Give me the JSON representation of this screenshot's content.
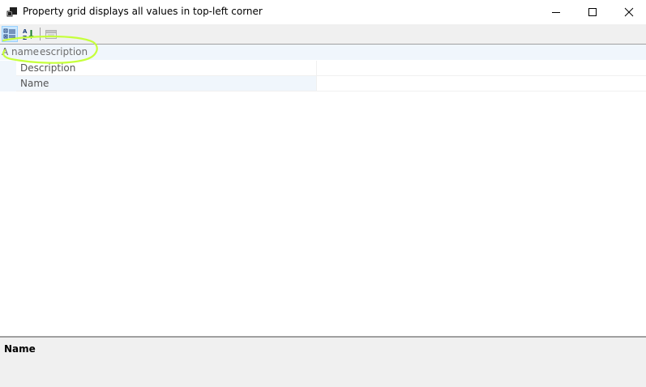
{
  "window": {
    "title": "Property grid displays all values in top-left corner",
    "buttons": {
      "minimize_icon": "minimize-icon",
      "maximize_icon": "maximize-icon",
      "close_icon": "close-icon"
    }
  },
  "toolbar": {
    "buttons": [
      {
        "name": "categorized",
        "icon": "categorized-icon",
        "active": true
      },
      {
        "name": "alphabetical",
        "icon": "sort-alphabetical-icon",
        "active": false
      },
      {
        "name": "property-pages",
        "icon": "property-pages-icon",
        "active": false,
        "disabled": true
      }
    ]
  },
  "grid": {
    "category_label": "A name",
    "overlap_text": "escription",
    "properties": [
      {
        "name": "Description",
        "value": ""
      },
      {
        "name": "Name",
        "value": ""
      }
    ]
  },
  "description_pane": {
    "title": "Name"
  },
  "colors": {
    "annotation": "#c6ff3c",
    "category_background": "#f0f6fc",
    "toolbar_background": "#f0f0f0",
    "active_button": "#cce8ff"
  }
}
